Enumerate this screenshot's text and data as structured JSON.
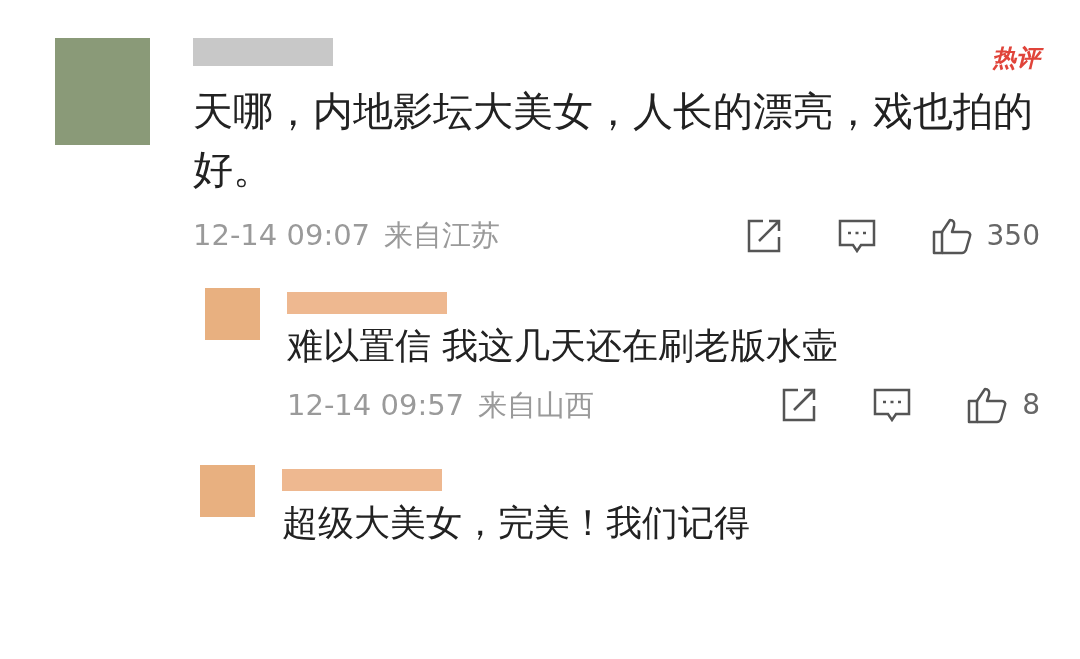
{
  "comments": [
    {
      "kind": "top",
      "badge": "热评",
      "text": "天哪，内地影坛大美女，人长的漂亮，戏也拍的好。",
      "time": "12-14 09:07",
      "location": "来自江苏",
      "likes": "350"
    },
    {
      "kind": "reply",
      "text": "难以置信 我这几天还在刷老版水壶",
      "time": "12-14 09:57",
      "location": "来自山西",
      "likes": "8"
    },
    {
      "kind": "reply",
      "text": "超级大美女，完美！我们记得"
    }
  ]
}
